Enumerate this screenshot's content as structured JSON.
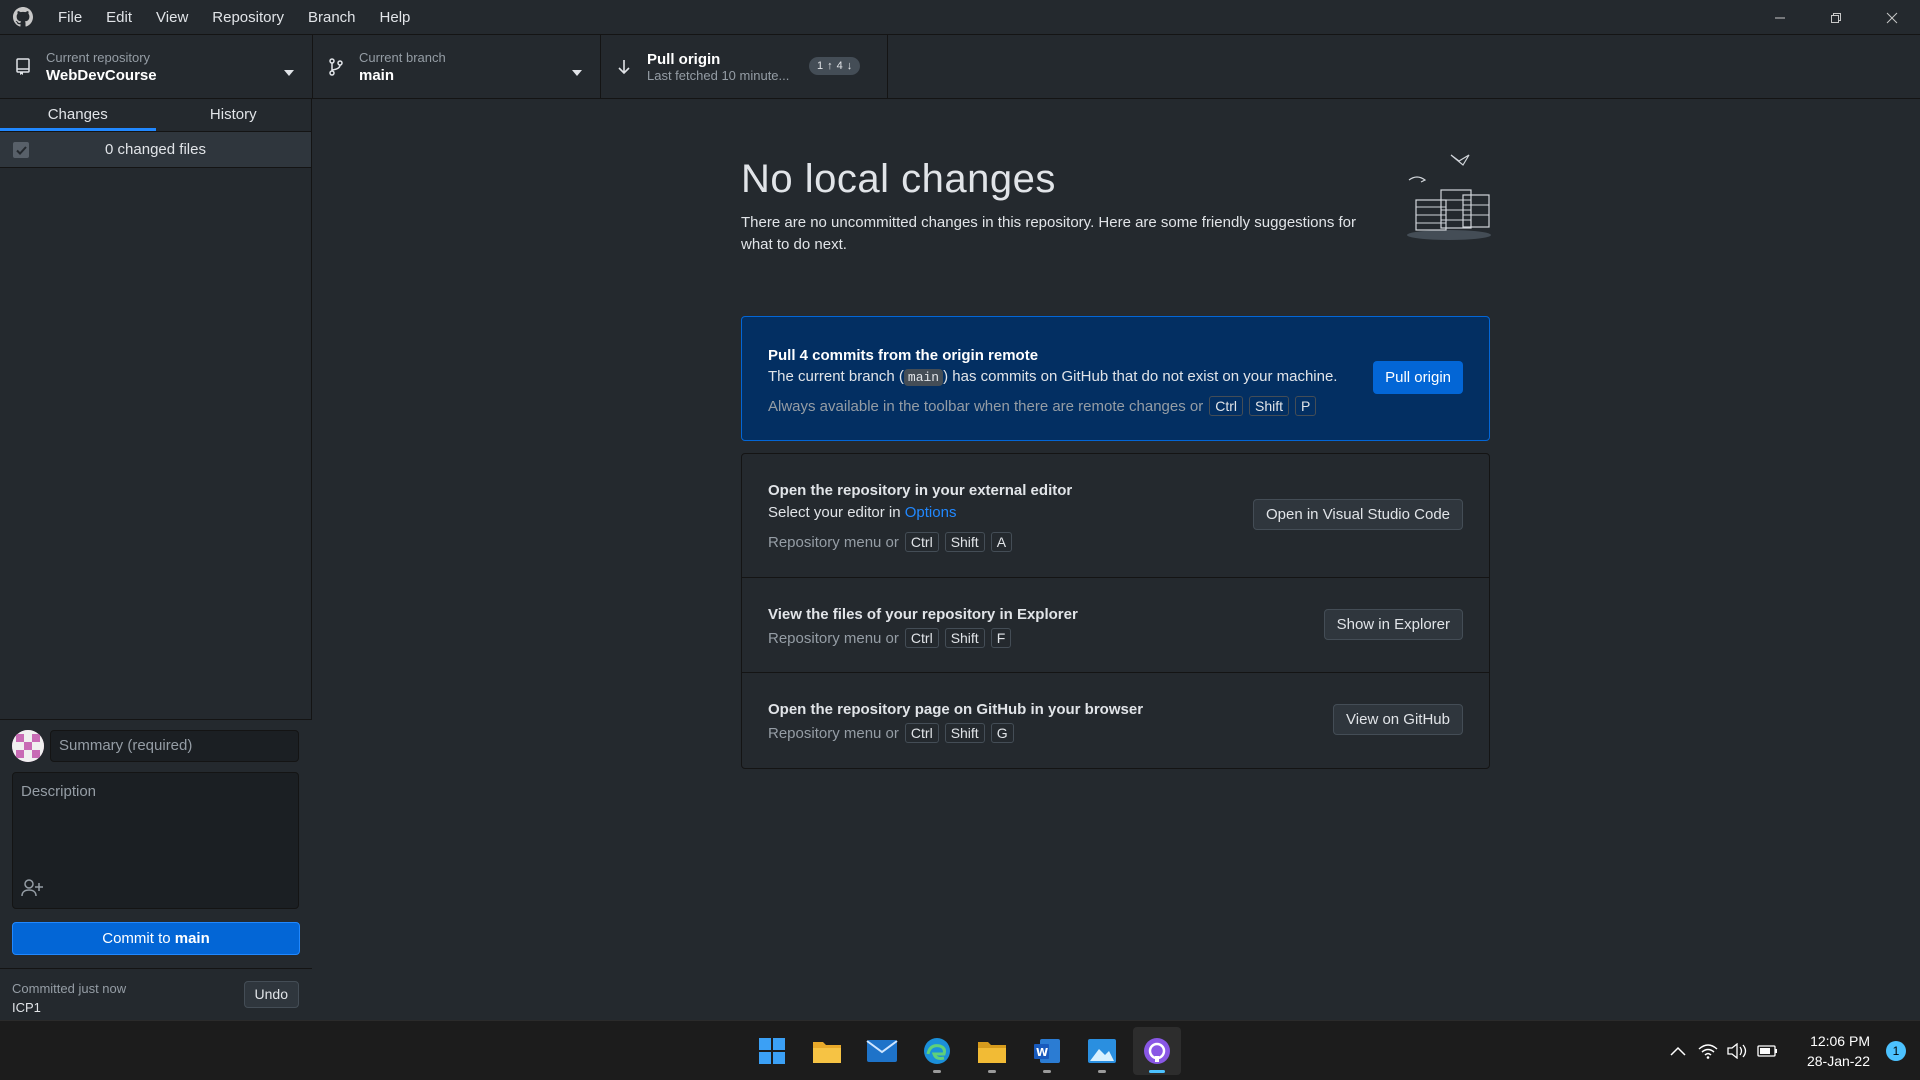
{
  "menu": {
    "items": [
      "File",
      "Edit",
      "View",
      "Repository",
      "Branch",
      "Help"
    ]
  },
  "toolbar": {
    "repo_label": "Current repository",
    "repo_value": "WebDevCourse",
    "branch_label": "Current branch",
    "branch_value": "main",
    "pull_label": "Pull origin",
    "pull_sub": "Last fetched 10 minute...",
    "ahead": "1",
    "behind": "4"
  },
  "sidebar": {
    "tabs": [
      "Changes",
      "History"
    ],
    "changed_files": "0 changed files",
    "summary_placeholder": "Summary (required)",
    "description_placeholder": "Description",
    "commit_prefix": "Commit to",
    "commit_branch": "main",
    "undo_label": "Committed just now",
    "undo_message": "ICP1",
    "undo_button": "Undo"
  },
  "main": {
    "title": "No local changes",
    "intro": "There are no uncommitted changes in this repository. Here are some friendly suggestions for what to do next.",
    "pull_callout": {
      "title": "Pull 4 commits from the origin remote",
      "desc_before": "The current branch (",
      "branch": "main",
      "desc_after": ") has commits on GitHub that do not exist on your machine.",
      "hint": "Always available in the toolbar when there are remote changes or",
      "keys": [
        "Ctrl",
        "Shift",
        "P"
      ],
      "button": "Pull origin"
    },
    "actions": [
      {
        "title": "Open the repository in your external editor",
        "sub_before": "Select your editor in",
        "sub_link": "Options",
        "hint": "Repository menu or",
        "keys": [
          "Ctrl",
          "Shift",
          "A"
        ],
        "button": "Open in Visual Studio Code"
      },
      {
        "title": "View the files of your repository in Explorer",
        "hint": "Repository menu or",
        "keys": [
          "Ctrl",
          "Shift",
          "F"
        ],
        "button": "Show in Explorer"
      },
      {
        "title": "Open the repository page on GitHub in your browser",
        "hint": "Repository menu or",
        "keys": [
          "Ctrl",
          "Shift",
          "G"
        ],
        "button": "View on GitHub"
      }
    ]
  },
  "taskbar": {
    "time": "12:06 PM",
    "date": "28-Jan-22",
    "notifications": "1"
  },
  "colors": {
    "accent": "#0366d6",
    "callout_bg": "#032f62",
    "link": "#2188ff"
  }
}
